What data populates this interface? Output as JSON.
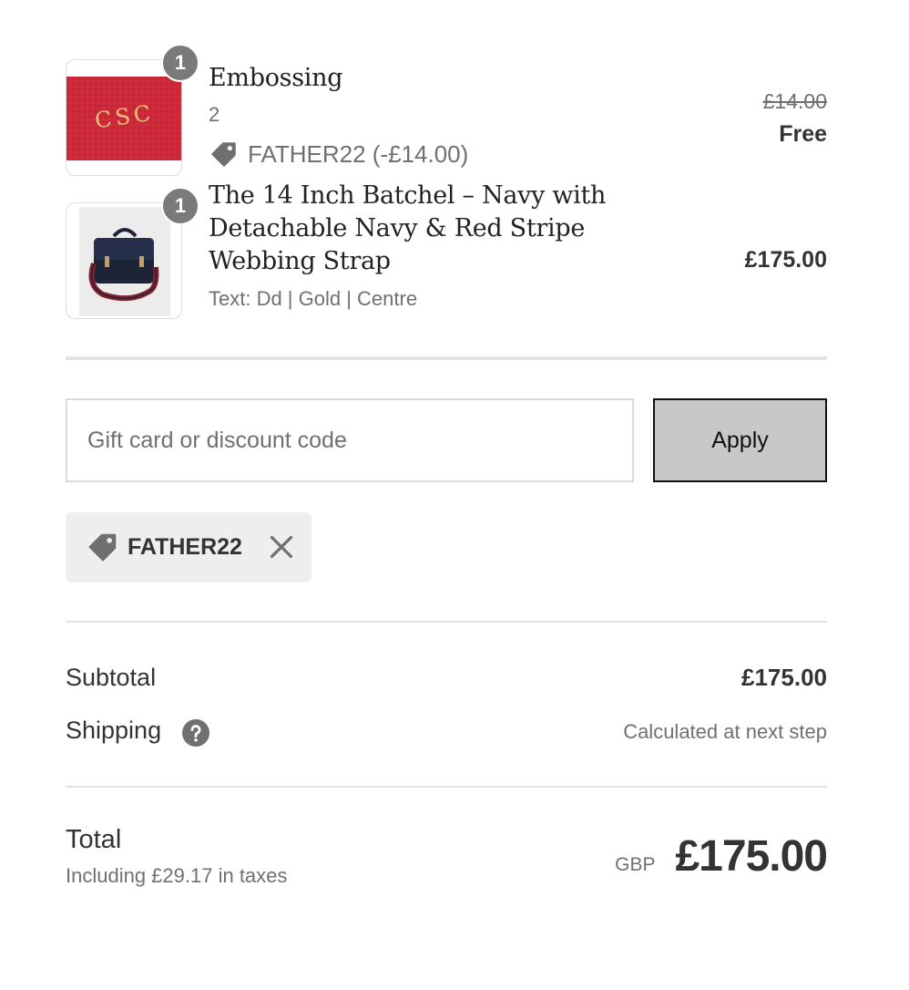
{
  "line_items": [
    {
      "quantity": "1",
      "title": "Embossing",
      "variant": "2",
      "discount": "FATHER22 (-£14.00)",
      "original_price": "£14.00",
      "price": "Free",
      "image_text": "CSC",
      "image_colors": {
        "background": "#cc2a3a",
        "monogram": "#e7c27a"
      }
    },
    {
      "quantity": "1",
      "title": "The 14 Inch Batchel – Navy with Detachable Navy & Red Stripe Webbing Strap",
      "variant": "Text: Dd | Gold | Centre",
      "price": "£175.00",
      "image_colors": {
        "bag": "#1d2438",
        "strap": "#8a1f2c"
      }
    }
  ],
  "discount_form": {
    "placeholder": "Gift card or discount code",
    "apply_label": "Apply"
  },
  "applied_discount": {
    "code": "FATHER22"
  },
  "summary": {
    "subtotal_label": "Subtotal",
    "subtotal_value": "£175.00",
    "shipping_label": "Shipping",
    "shipping_value": "Calculated at next step",
    "total_label": "Total",
    "taxes_note": "Including £29.17 in taxes",
    "currency": "GBP",
    "total_value": "£175.00"
  },
  "icons": [
    "tag-icon",
    "close-icon",
    "help-icon"
  ],
  "colors": {
    "badge": "#7a7a7a",
    "apply_button": "#c8c8c8",
    "chip": "#eeeeee"
  }
}
